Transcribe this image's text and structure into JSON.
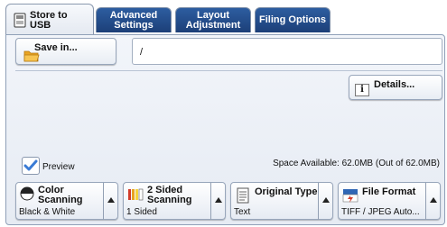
{
  "tabs": [
    {
      "line1": "Store to",
      "line2": "USB",
      "active": true
    },
    {
      "line1": "Advanced",
      "line2": "Settings",
      "active": false
    },
    {
      "line1": "Layout",
      "line2": "Adjustment",
      "active": false
    },
    {
      "line1": "Filing Options",
      "line2": "",
      "active": false
    }
  ],
  "save": {
    "label": "Save in...",
    "path": "/"
  },
  "details_label": "Details...",
  "preview": {
    "label": "Preview",
    "checked": true
  },
  "space_available": "Space Available: 62.0MB (Out of 62.0MB)",
  "controls": [
    {
      "title_line1": "Color",
      "title_line2": "Scanning",
      "value": "Black & White"
    },
    {
      "title_line1": "2 Sided",
      "title_line2": "Scanning",
      "value": "1 Sided"
    },
    {
      "title_line1": "Original Type",
      "title_line2": "",
      "value": "Text"
    },
    {
      "title_line1": "File Format",
      "title_line2": "",
      "value": "TIFF / JPEG Auto..."
    }
  ],
  "icons": {
    "usb_tab": "usb-drive-icon",
    "save_folder": "folder-icon",
    "details": "info-icon",
    "preview_check": "checkmark-icon",
    "color": "color-scanning-icon",
    "two_sided": "two-sided-icon",
    "original_type": "document-icon",
    "file_format": "file-format-icon"
  },
  "colors": {
    "tab_blue": "#1f4a8a",
    "folder": "#f2b233",
    "check": "#3a7bd5",
    "accent_red": "#d23b2a"
  }
}
